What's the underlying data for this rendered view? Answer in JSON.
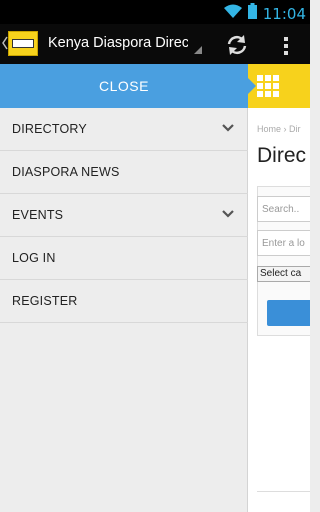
{
  "status_bar": {
    "time": "11:04",
    "icons": [
      "wifi-icon",
      "battery-icon"
    ],
    "accent_color": "#33b5e5"
  },
  "action_bar": {
    "title": "Kenya Diaspora Directory",
    "icons": [
      "up-arrow-icon",
      "app-logo",
      "refresh-icon",
      "overflow-menu-icon"
    ]
  },
  "drawer": {
    "close_label": "CLOSE",
    "header_color": "#4a9fe0",
    "items": [
      {
        "label": "DIRECTORY",
        "expandable": true
      },
      {
        "label": "DIASPORA NEWS",
        "expandable": false
      },
      {
        "label": "EVENTS",
        "expandable": true
      },
      {
        "label": "LOG IN",
        "expandable": false
      },
      {
        "label": "REGISTER",
        "expandable": false
      }
    ]
  },
  "page": {
    "header_color": "#f7d21c",
    "breadcrumb": "Home › Dir",
    "title": "Direc",
    "search_placeholder": "Search..",
    "location_placeholder": "Enter a lo",
    "category_select": "Select ca"
  }
}
